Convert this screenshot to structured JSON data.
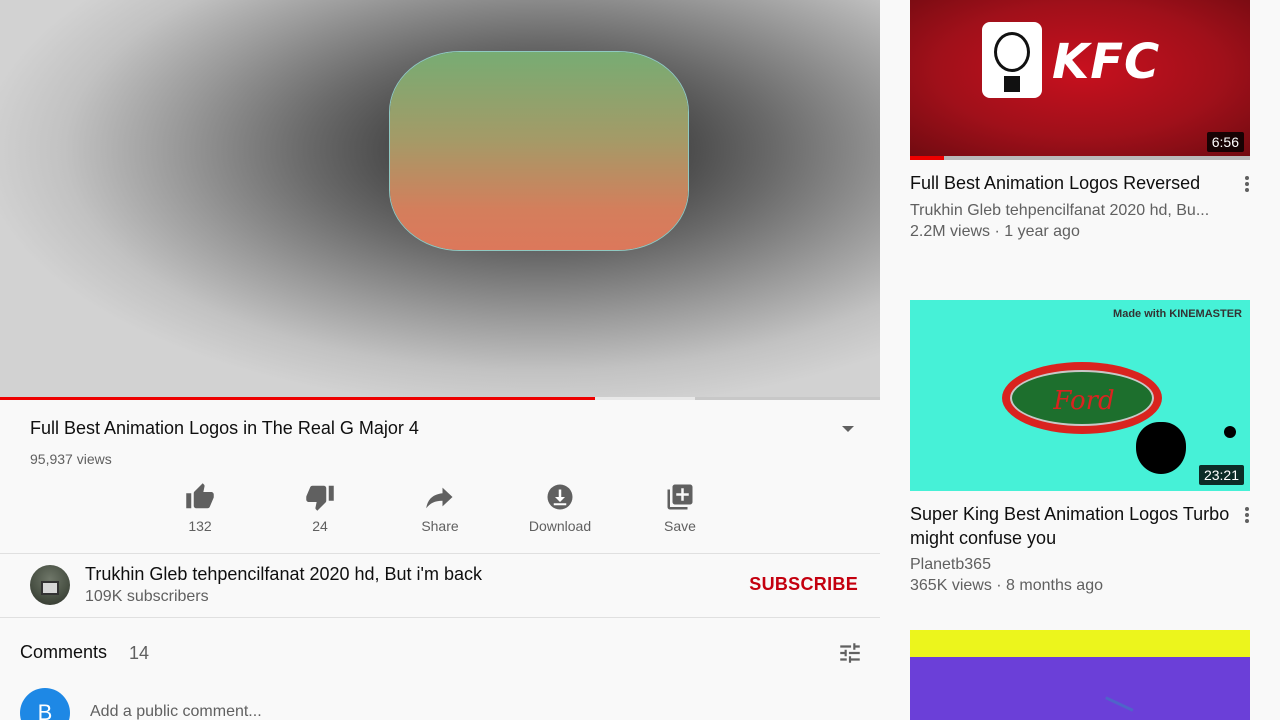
{
  "colors": {
    "accent_red": "#c4000f",
    "progress_red": "#ee0000",
    "text_primary": "#0f0f0f",
    "text_secondary": "#606060",
    "background": "#f9f9f9"
  },
  "player": {
    "progress_played_fraction": 0.676,
    "progress_buffered_fraction": 0.79
  },
  "video": {
    "title": "Full Best Animation Logos in The Real G Major 4",
    "views": "95,937 views"
  },
  "actions": [
    {
      "icon": "thumb-up-icon",
      "label": "132"
    },
    {
      "icon": "thumb-down-icon",
      "label": "24"
    },
    {
      "icon": "share-icon",
      "label": "Share"
    },
    {
      "icon": "download-icon",
      "label": "Download"
    },
    {
      "icon": "playlist-add-icon",
      "label": "Save"
    }
  ],
  "channel": {
    "name": "Trukhin Gleb tehpencilfanat 2020 hd, But i'm back",
    "subscribers": "109K subscribers",
    "subscribe_label": "SUBSCRIBE"
  },
  "comments": {
    "title": "Comments",
    "count": "14",
    "avatar_letter": "B",
    "placeholder": "Add a public comment..."
  },
  "recommendations": [
    {
      "thumb_text": "KFC",
      "duration": "6:56",
      "watched_fraction": 0.1,
      "title": "Full Best Animation Logos Reversed",
      "channel": "Trukhin Gleb tehpencilfanat 2020 hd, Bu...",
      "meta": "2.2M views · 1 year ago"
    },
    {
      "thumb_watermark": "Made with KINEMASTER",
      "thumb_text": "Ford",
      "duration": "23:21",
      "title": "Super King Best Animation Logos Turbo might confuse you",
      "channel": "Planetb365",
      "meta": "365K views · 8 months ago"
    },
    {
      "title": ""
    }
  ]
}
